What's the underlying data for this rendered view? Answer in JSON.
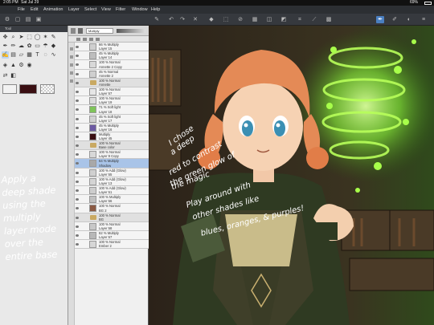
{
  "status_bar": {
    "time": "2:05 PM",
    "date": "Sat Jul 29",
    "battery": "69%"
  },
  "menu": [
    "File",
    "Edit",
    "Animation",
    "Layer",
    "Select",
    "View",
    "Filter",
    "Window",
    "Help"
  ],
  "tool_panel": {
    "tab_label": "Tool"
  },
  "layer_panel": {
    "blend_mode": "Multiply",
    "layers": [
      {
        "line1": "66 % Multiply",
        "line2": "Layer 15",
        "kind": "layer",
        "thumb": "#cfcfcf"
      },
      {
        "line1": "45 % Multiply",
        "line2": "Layer 14",
        "kind": "layer",
        "thumb": "#bdbdbd"
      },
      {
        "line1": "100 % Normal",
        "line2": "Annette 2 Copy",
        "kind": "layer",
        "thumb": "#d8d8d8"
      },
      {
        "line1": "45 % Normal",
        "line2": "Annette 2",
        "kind": "layer",
        "thumb": "#cfcfcf"
      },
      {
        "line1": "100 % Normal",
        "line2": "Annette",
        "kind": "folder",
        "thumb": ""
      },
      {
        "line1": "100 % Normal",
        "line2": "Layer 57",
        "kind": "layer",
        "thumb": "#e6e6e6"
      },
      {
        "line1": "100 % Normal",
        "line2": "Layer 19",
        "kind": "layer",
        "thumb": "#dcdcdc"
      },
      {
        "line1": "71 % Soft light",
        "line2": "Layer 18",
        "kind": "layer",
        "thumb": "#7fc45a"
      },
      {
        "line1": "45 % Soft light",
        "line2": "Layer 17",
        "kind": "layer",
        "thumb": "#d0d0d0"
      },
      {
        "line1": "45 % Multiply",
        "line2": "Layer 16",
        "kind": "layer",
        "thumb": "#6d5aa3"
      },
      {
        "line1": "Multiply",
        "line2": "Layer 45",
        "kind": "layer",
        "thumb": "#3a0f12"
      },
      {
        "line1": "100 % Normal",
        "line2": "Base color",
        "kind": "folder",
        "thumb": ""
      },
      {
        "line1": "100 % Normal",
        "line2": "Layer 9 Copy",
        "kind": "layer",
        "thumb": "#d8d8d8"
      },
      {
        "line1": "64 % Multiply",
        "line2": "Shadow",
        "kind": "layer",
        "thumb": "#a8a8a8"
      },
      {
        "line1": "100 % Add (Glow)",
        "line2": "Layer 55",
        "kind": "layer",
        "thumb": "#d0d0d0"
      },
      {
        "line1": "100 % Add (Glow)",
        "line2": "Layer 13",
        "kind": "layer",
        "thumb": "#d4d4d4"
      },
      {
        "line1": "100 % Add (Glow)",
        "line2": "Layer 51",
        "kind": "layer",
        "thumb": "#cdcdcd"
      },
      {
        "line1": "100 % Multiply",
        "line2": "Layer 56",
        "kind": "layer",
        "thumb": "#c0c0c0"
      },
      {
        "line1": "100 % Normal",
        "line2": "BG 2",
        "kind": "layer",
        "thumb": "#8b5a44"
      },
      {
        "line1": "100 % Normal",
        "line2": "BG",
        "kind": "folder",
        "thumb": ""
      },
      {
        "line1": "100 % Normal",
        "line2": "Layer 58",
        "kind": "layer",
        "thumb": "#c8c8c8"
      },
      {
        "line1": "62 % Multiply",
        "line2": "Layer 57",
        "kind": "layer",
        "thumb": "#b8b8b8"
      },
      {
        "line1": "100 % Normal",
        "line2": "Ember 2",
        "kind": "layer",
        "thumb": "#d6d6d6"
      }
    ],
    "selected_index": 13
  },
  "annotations": {
    "left": [
      "Apply a",
      "deep shade",
      "using the",
      "multiply",
      "layer mode",
      "over the",
      "entire base"
    ],
    "canvas": [
      "I chose",
      "a deep",
      "red to contrast",
      "the green glow of",
      "the magic",
      "Play around with",
      "other shades like",
      "blues, oranges, & purples!"
    ]
  },
  "colors": {
    "main_color": "#3a0f12",
    "sub_color": "#f2f2f2",
    "accent": "#4a7fc1",
    "magic_glow": "#8cff3a"
  }
}
